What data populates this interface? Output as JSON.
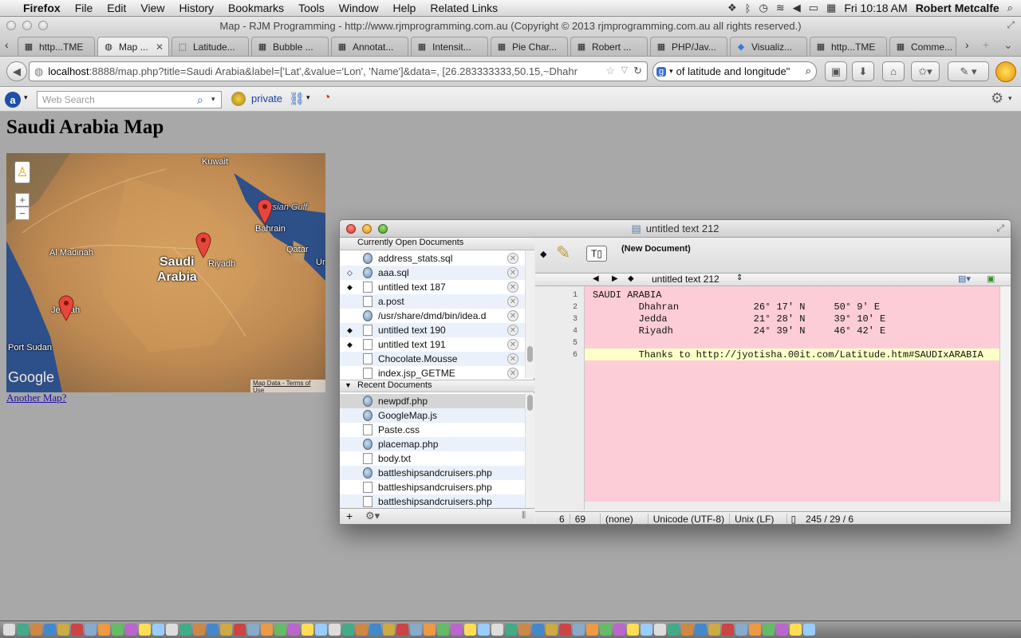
{
  "menubar": {
    "app": "Firefox",
    "items": [
      "File",
      "Edit",
      "View",
      "History",
      "Bookmarks",
      "Tools",
      "Window",
      "Help",
      "Related Links"
    ],
    "clock": "Fri 10:18 AM",
    "user": "Robert Metcalfe"
  },
  "window_title": "Map - RJM Programming - http://www.rjmprogramming.com.au (Copyright © 2013 rjmprogramming.com.au all rights reserved.)",
  "tabs": [
    {
      "label": "http...TME"
    },
    {
      "label": "Map ..."
    },
    {
      "label": "Latitude..."
    },
    {
      "label": "Bubble ..."
    },
    {
      "label": "Annotat..."
    },
    {
      "label": "Intensit..."
    },
    {
      "label": "Pie Char..."
    },
    {
      "label": "Robert ..."
    },
    {
      "label": "PHP/Jav..."
    },
    {
      "label": "Visualiz..."
    },
    {
      "label": "http...TME"
    },
    {
      "label": "Comme..."
    }
  ],
  "urlbar": {
    "host": "localhost",
    "path": ":8888/map.php?title=Saudi Arabia&label=['Lat',&value='Lon', 'Name']&data=, [26.283333333,50.15,~Dhahr"
  },
  "searchbar": {
    "value": "of latitude and longitude\""
  },
  "addonbar": {
    "placeholder": "Web Search",
    "private_label": "private"
  },
  "page": {
    "title": "Saudi Arabia Map",
    "another_link": "Another Map?"
  },
  "map": {
    "labels": {
      "kuwait": "Kuwait",
      "gulf": "rsian Gulf",
      "bahrain": "Bahrain",
      "qatar": "Qatar",
      "ur": "Ur",
      "madinah": "Al Madinah",
      "saudi1": "Saudi",
      "saudi2": "Arabia",
      "riyadh": "Riyadh",
      "jeddah": "Jeddah",
      "portsudan": "Port Sudan"
    },
    "logo": "Google",
    "attribution": "Map Data - Terms of Use",
    "zoom_in": "+",
    "zoom_out": "−"
  },
  "editor": {
    "title": "untitled text 212",
    "open_header": "Currently Open Documents",
    "open_docs": [
      {
        "name": "address_stats.sql",
        "mark": "",
        "kind": "globe"
      },
      {
        "name": "aaa.sql",
        "mark": "◇",
        "kind": "globe"
      },
      {
        "name": "untitled text 187",
        "mark": "◆",
        "kind": "doc"
      },
      {
        "name": "a.post",
        "mark": "",
        "kind": "doc"
      },
      {
        "name": "/usr/share/dmd/bin/idea.d",
        "mark": "",
        "kind": "globe"
      },
      {
        "name": "untitled text 190",
        "mark": "◆",
        "kind": "doc"
      },
      {
        "name": "untitled text 191",
        "mark": "◆",
        "kind": "doc"
      },
      {
        "name": "Chocolate.Mousse",
        "mark": "",
        "kind": "doc"
      },
      {
        "name": "index.jsp_GETME",
        "mark": "",
        "kind": "doc"
      }
    ],
    "recent_header": "Recent Documents",
    "recent_docs": [
      {
        "name": "newpdf.php",
        "kind": "globe"
      },
      {
        "name": "GoogleMap.js",
        "kind": "globe"
      },
      {
        "name": "Paste.css",
        "kind": "doc"
      },
      {
        "name": "placemap.php",
        "kind": "globe"
      },
      {
        "name": "body.txt",
        "kind": "doc"
      },
      {
        "name": "battleshipsandcruisers.php",
        "kind": "globe"
      },
      {
        "name": "battleshipsandcruisers.php",
        "kind": "doc"
      },
      {
        "name": "battleshipsandcruisers.php",
        "kind": "doc"
      }
    ],
    "doc_status": "(New Document)",
    "nav_doc": "untitled text 212",
    "lines": [
      "SAUDI ARABIA",
      "        Dhahran             26° 17' N     50° 9' E",
      "        Jedda               21° 28' N     39° 10' E",
      "        Riyadh              24° 39' N     46° 42' E",
      "",
      "        Thanks to http://jyotisha.00it.com/Latitude.htm#SAUDIxARABIA"
    ],
    "status": {
      "line": "6",
      "col": "69",
      "language": "(none)",
      "encoding": "Unicode (UTF-8)",
      "line_endings": "Unix (LF)",
      "counts": "245 / 29 / 6"
    }
  }
}
